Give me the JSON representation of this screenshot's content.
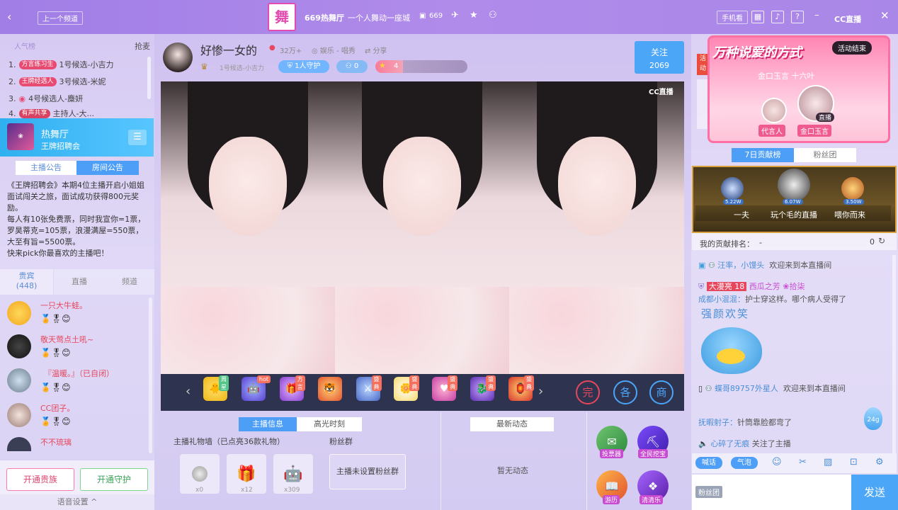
{
  "topbar": {
    "back_icon": "chevron-left-icon",
    "prev_channel": "上一个频道",
    "room_logo_text": "舞",
    "room_name": "669热舞厅",
    "room_slogan": "一个人舞动一座城",
    "room_id": "669",
    "phone_view": "手机看",
    "help": "?",
    "brand": "CC直播"
  },
  "left": {
    "rank_header": "人气榜",
    "rank_more": "抢麦",
    "rank_items": [
      {
        "num": "1.",
        "tag": "方言练习生",
        "text": "1号候选-小吉力"
      },
      {
        "num": "2.",
        "tag": "王牌经选人",
        "text": "3号候选-米妮"
      },
      {
        "num": "3.",
        "tag": "",
        "text": "4号候选人-麋妍"
      },
      {
        "num": "4.",
        "tag": "有声共享",
        "text": "主持人-大..."
      }
    ],
    "channel_name": "热舞厅",
    "channel_sub": "王牌招聘会",
    "tab_host_notice": "主播公告",
    "tab_room_notice": "房间公告",
    "notice": "《王牌招聘会》本期4位主播开启小姐姐面试闯关之旅，面试成功获得800元奖励。\n每人有10张免费票，同时我宣你=1票，罗昊蒂克=105票，浪漫满屋=550票，大至有旨=5500票。\n快来pick你最喜欢的主播吧！",
    "tab_guests": "贵宾",
    "guest_count": "(448)",
    "tab_live": "直播",
    "tab_channel": "频道",
    "users": [
      {
        "name": "一只大牛蛙。",
        "color": "#e8465d"
      },
      {
        "name": "敬天莺点土吼~",
        "color": "#e8465d"
      },
      {
        "name": "『温暖。』（已自闭）",
        "color": "#e8465d"
      },
      {
        "name": "CC团子。",
        "color": "#e8465d"
      },
      {
        "name": "不不琉璃",
        "color": "#e8465d"
      }
    ],
    "open_noble": "开通贵族",
    "open_guard": "开通守护",
    "voice_settings": "语音设置"
  },
  "host": {
    "name": "好惨一女的",
    "followers": "32万+",
    "category": "娱乐 - 唱秀",
    "share": "分享",
    "rank_text": "1号候选-小吉力",
    "guard": "1人守护",
    "fans": "0",
    "level": "4",
    "follow_label": "关注",
    "follow_count": "2069",
    "cc_mark": "CC直播"
  },
  "gifts": [
    {
      "name": "gift-chick",
      "badge": "周星"
    },
    {
      "name": "gift-robot",
      "badge": "hot"
    },
    {
      "name": "gift-box",
      "badge": "方言"
    },
    {
      "name": "gift-tiger",
      "badge": ""
    },
    {
      "name": "gift-knight",
      "badge": "盛典"
    },
    {
      "name": "gift-flower",
      "badge": "盛典"
    },
    {
      "name": "gift-heart",
      "badge": "盛典"
    },
    {
      "name": "gift-dragon",
      "badge": "盛典"
    },
    {
      "name": "gift-lantern",
      "badge": "盛典"
    }
  ],
  "gift_actions": [
    "完",
    "各",
    "商"
  ],
  "bottom": {
    "tab_host_info": "主播信息",
    "tab_highlights": "高光时刻",
    "gift_wall": "主播礼物墙（已点亮36款礼物）",
    "gift_counts": [
      "x0",
      "x12",
      "x309"
    ],
    "fan_group": "粉丝群",
    "fan_group_msg": "主播未设置粉丝群",
    "latest_news": "最新动态",
    "no_news": "暂无动态",
    "activities": [
      "投票器",
      "全民挖宝",
      "游历",
      "清清乐"
    ]
  },
  "right": {
    "banner_title": "万种说爱的方式",
    "banner_status": "活动结束",
    "banner_side": "活动",
    "banner_sub": "金口玉言 十六叶",
    "spokesman": "代言人",
    "spokesman_name": "金口玉言",
    "live_badge": "直播",
    "tab_7day": "7日贡献榜",
    "tab_fans": "粉丝团",
    "podium": [
      {
        "name": "一夫",
        "score": "5.22W"
      },
      {
        "name": "玩个毛的直播",
        "score": "6.07W"
      },
      {
        "name": "喂你而来",
        "score": "3.50W"
      }
    ],
    "my_rank_label": "我的贡献排名：",
    "my_rank_value": "-",
    "my_score": "0",
    "chat": [
      {
        "user": "汪率，小馒头",
        "msg": "欢迎来到本直播间"
      },
      {
        "user": "大漫亮 18",
        "msg": "西瓜之芳 ❀拾柒"
      },
      {
        "user": "成都小混混：",
        "msg": "护士穿这样。哪个病人受得了"
      },
      {
        "user": "",
        "msg": "强颜欢笑"
      },
      {
        "user": "蝶哥89757外星人",
        "msg": "欢迎来到本直播间"
      },
      {
        "user": "抚暇射子：",
        "msg": "针筒靠脸都弯了"
      },
      {
        "user": "心碎了无痕",
        "msg": "关注了主播"
      }
    ],
    "bubble_count": "24g",
    "btn_talk": "喊话",
    "btn_bubble": "气泡",
    "fan_badge": "粉丝团",
    "send": "发送"
  }
}
